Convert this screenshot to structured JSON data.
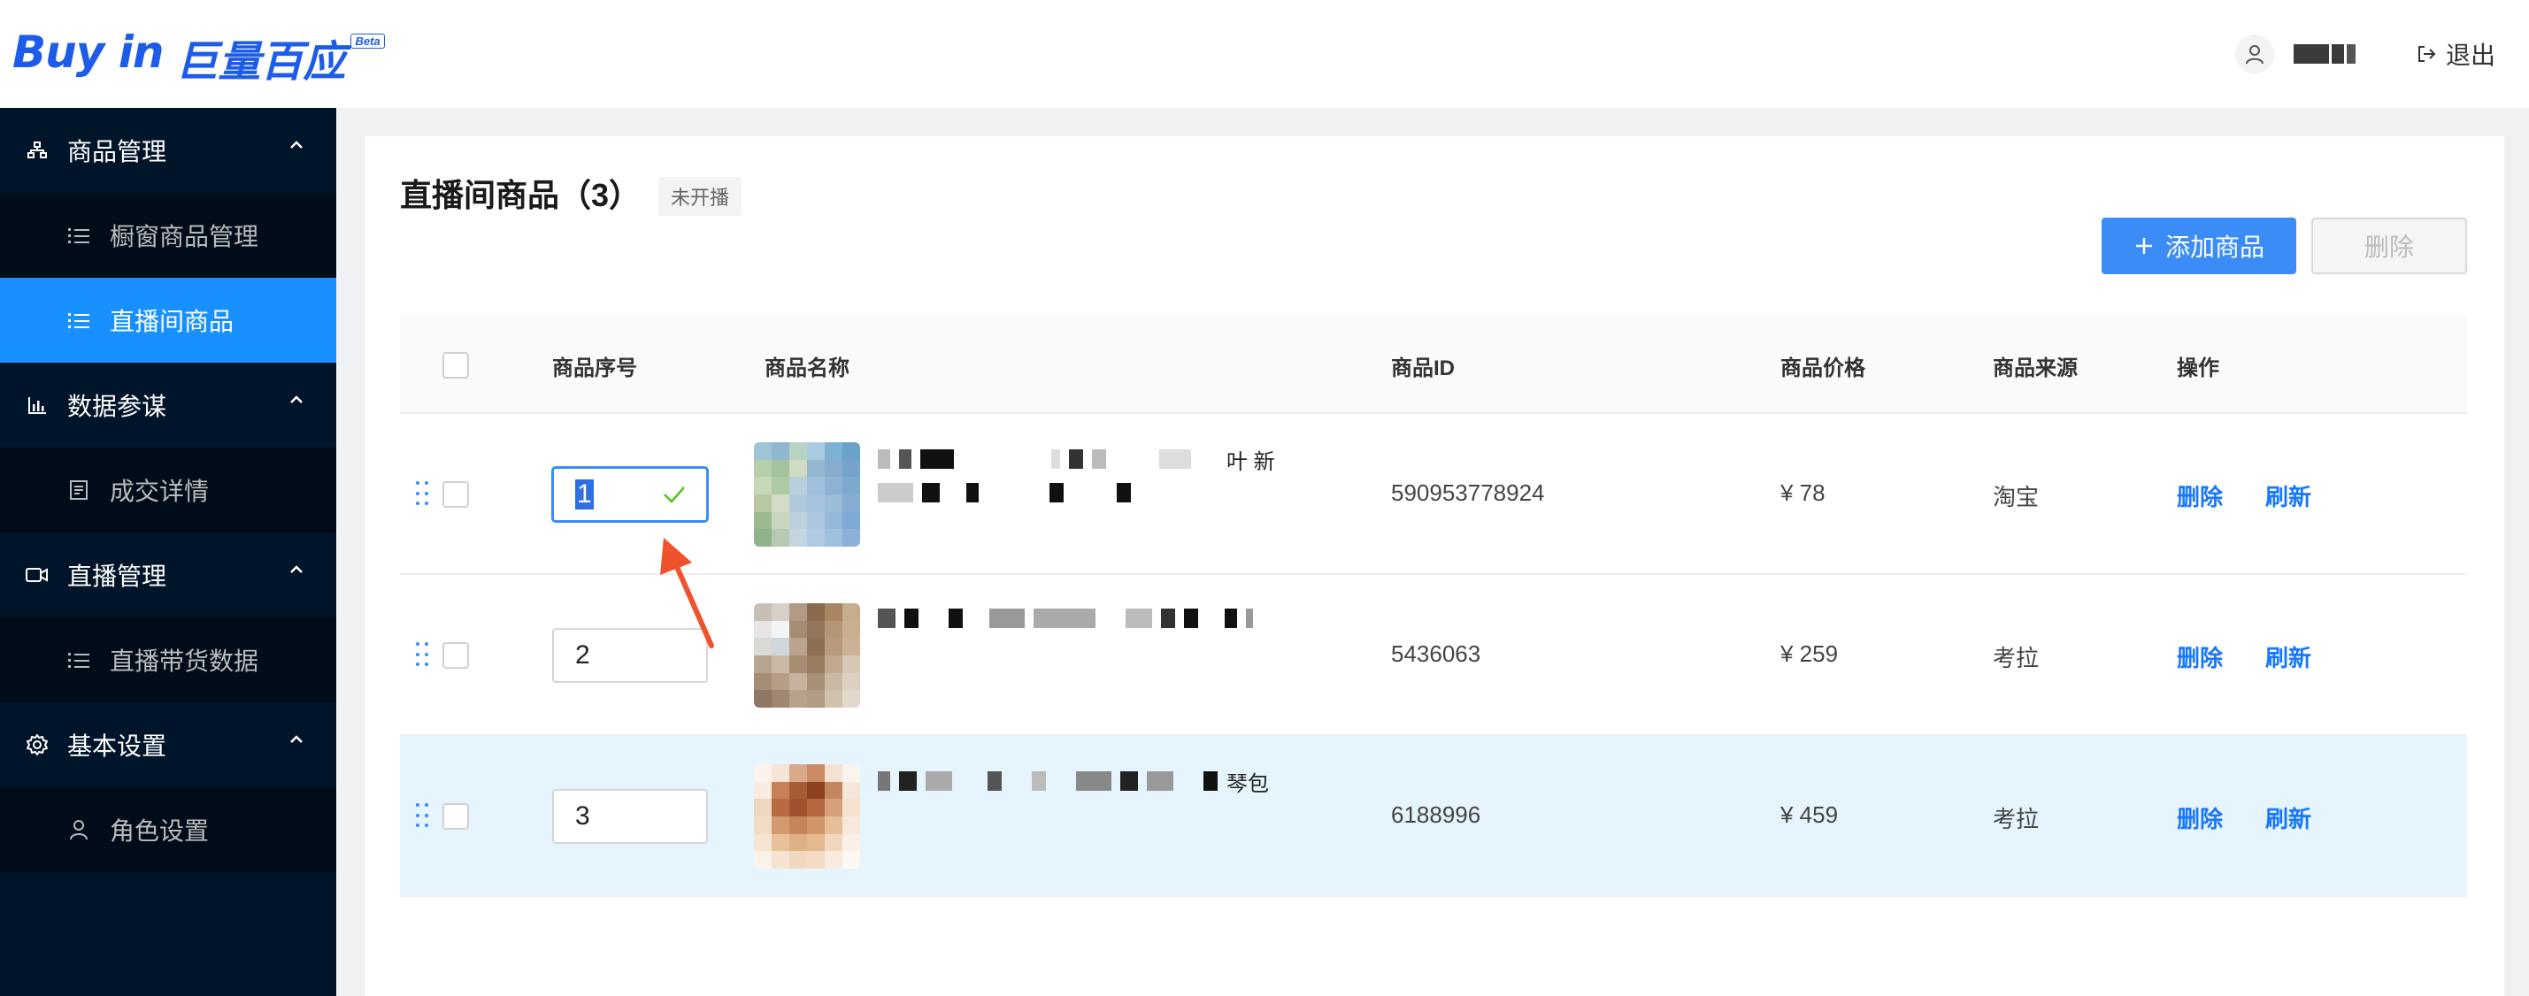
{
  "header": {
    "logo_text": "Buy in",
    "logo_cn": "巨量百应",
    "logo_badge": "Beta",
    "logout_label": "退出"
  },
  "sidebar": {
    "groups": [
      {
        "label": "商品管理",
        "icon": "product-tree-icon",
        "items": [
          {
            "label": "橱窗商品管理",
            "active": false
          },
          {
            "label": "直播间商品",
            "active": true
          }
        ]
      },
      {
        "label": "数据参谋",
        "icon": "bar-chart-icon",
        "items": [
          {
            "label": "成交详情",
            "active": false
          }
        ]
      },
      {
        "label": "直播管理",
        "icon": "video-camera-icon",
        "items": [
          {
            "label": "直播带货数据",
            "active": false
          }
        ]
      },
      {
        "label": "基本设置",
        "icon": "gear-icon",
        "items": [
          {
            "label": "角色设置",
            "active": false
          }
        ]
      }
    ]
  },
  "page": {
    "title": "直播间商品（3）",
    "status_tag": "未开播",
    "add_button": "添加商品",
    "delete_button": "删除"
  },
  "table": {
    "columns": [
      "商品序号",
      "商品名称",
      "商品ID",
      "商品价格",
      "商品来源",
      "操作"
    ],
    "rows": [
      {
        "seq": "1",
        "name_fragment": "叶 新",
        "id": "590953778924",
        "price": "¥ 78",
        "source": "淘宝",
        "op_delete": "删除",
        "op_refresh": "刷新",
        "highlighted": false
      },
      {
        "seq": "2",
        "name_fragment": "",
        "id": "5436063",
        "price": "¥ 259",
        "source": "考拉",
        "op_delete": "删除",
        "op_refresh": "刷新",
        "highlighted": false
      },
      {
        "seq": "3",
        "name_fragment": "琴包",
        "id": "6188996",
        "price": "¥ 459",
        "source": "考拉",
        "op_delete": "删除",
        "op_refresh": "刷新",
        "highlighted": true
      }
    ]
  },
  "colors": {
    "sidebar_bg": "#001529",
    "accent": "#1890ff",
    "link": "#1677ff",
    "highlight_row": "#e6f4fd",
    "annotation_arrow": "#f0522c"
  }
}
